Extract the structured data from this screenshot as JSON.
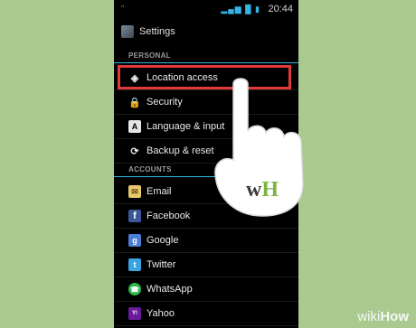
{
  "status_bar": {
    "left_text": "′′",
    "icons": [
      "signal-icon",
      "wifi-icon",
      "signal-icon",
      "battery-icon"
    ],
    "time": "20:44"
  },
  "action_bar": {
    "title": "Settings",
    "icon": "settings-app-icon"
  },
  "sections": [
    {
      "header": "PERSONAL",
      "items": [
        {
          "label": "Location access",
          "icon": "location-icon",
          "highlighted": true
        },
        {
          "label": "Security",
          "icon": "lock-icon"
        },
        {
          "label": "Language & input",
          "icon": "keyboard-icon"
        },
        {
          "label": "Backup & reset",
          "icon": "backup-icon"
        }
      ]
    },
    {
      "header": "ACCOUNTS",
      "items": [
        {
          "label": "Email",
          "icon": "email-icon"
        },
        {
          "label": "Facebook",
          "icon": "facebook-icon"
        },
        {
          "label": "Google",
          "icon": "google-icon"
        },
        {
          "label": "Twitter",
          "icon": "twitter-icon"
        },
        {
          "label": "WhatsApp",
          "icon": "whatsapp-icon"
        },
        {
          "label": "Yahoo",
          "icon": "yahoo-icon"
        }
      ]
    }
  ],
  "overlay": {
    "logo_w": "w",
    "logo_h": "H"
  },
  "watermark": {
    "wiki": "wiki",
    "how": "How"
  },
  "colors": {
    "highlight": "#e23a3a",
    "accent": "#33b5e5",
    "background": "#a9c98f"
  }
}
